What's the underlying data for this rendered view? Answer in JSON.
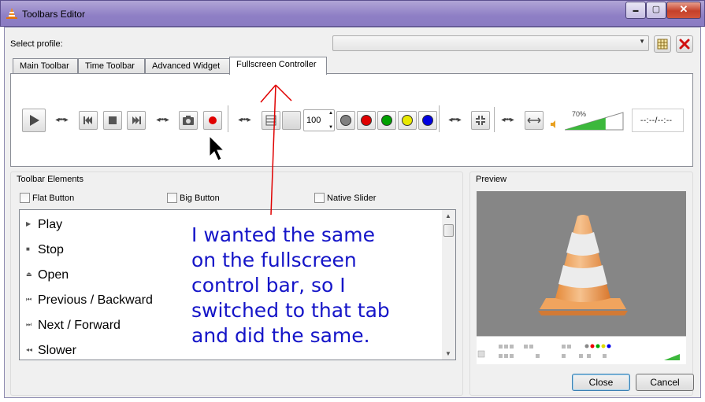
{
  "window": {
    "title": "Toolbars Editor",
    "controls": {
      "minimize": "▬",
      "maximize": "▢",
      "close": "✕"
    }
  },
  "profile": {
    "label": "Select profile:",
    "value": ""
  },
  "tabs": [
    {
      "label": "Main Toolbar",
      "active": false
    },
    {
      "label": "Time Toolbar",
      "active": false
    },
    {
      "label": "Advanced Widget",
      "active": false
    },
    {
      "label": "Fullscreen Controller",
      "active": true
    }
  ],
  "toolbar": {
    "speed_value": "100",
    "volume_percent": "70%",
    "volume_level": 0.7,
    "time_display": "--:--/--:--",
    "colors": [
      "#808080",
      "#e00000",
      "#00a000",
      "#e8e800",
      "#0000e0"
    ]
  },
  "toolbar_elements": {
    "title": "Toolbar Elements",
    "options": [
      {
        "label": "Flat Button",
        "checked": false
      },
      {
        "label": "Big Button",
        "checked": false
      },
      {
        "label": "Native Slider",
        "checked": false
      }
    ],
    "items": [
      {
        "glyph": "▶",
        "label": "Play"
      },
      {
        "glyph": "■",
        "label": "Stop"
      },
      {
        "glyph": "⏏",
        "label": "Open"
      },
      {
        "glyph": "⏮",
        "label": "Previous / Backward"
      },
      {
        "glyph": "⏭",
        "label": "Next / Forward"
      },
      {
        "glyph": "◂◂",
        "label": "Slower"
      }
    ]
  },
  "preview": {
    "title": "Preview"
  },
  "buttons": {
    "close": "Close",
    "cancel": "Cancel"
  },
  "annotation": "I wanted the same\non the fullscreen\ncontrol bar, so I\nswitched to that tab\nand did the same.",
  "accent_colors": {
    "annotation_text": "#1515c8",
    "annotation_arrow": "#e00000",
    "record": "#e00000",
    "volume_green": "#3cb83c"
  }
}
